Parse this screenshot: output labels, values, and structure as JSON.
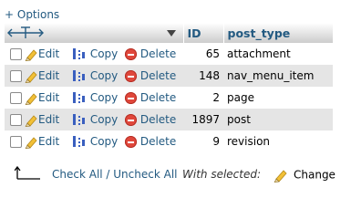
{
  "options_label": "+ Options",
  "columns": {
    "id": "ID",
    "post_type": "post_type"
  },
  "actions": {
    "edit": "Edit",
    "copy": "Copy",
    "delete": "Delete"
  },
  "rows": [
    {
      "id": "65",
      "post_type": "attachment"
    },
    {
      "id": "148",
      "post_type": "nav_menu_item"
    },
    {
      "id": "2",
      "post_type": "page"
    },
    {
      "id": "1897",
      "post_type": "post"
    },
    {
      "id": "9",
      "post_type": "revision"
    }
  ],
  "footer": {
    "check_all": "Check All / Uncheck All",
    "with_selected": "With selected:",
    "change": "Change"
  },
  "colors": {
    "link": "#235a81",
    "row_even": "#e5e5e5",
    "delete": "#e0473b"
  }
}
